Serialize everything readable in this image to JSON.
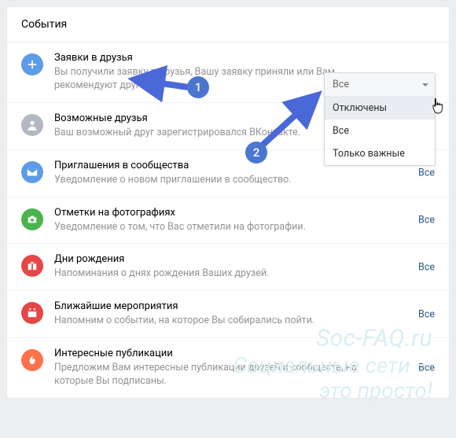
{
  "header": {
    "title": "События"
  },
  "rows": [
    {
      "icon": "plus-icon",
      "color": "ic-blue",
      "title": "Заявки в друзья",
      "desc": "Вы получили заявку в друзья, Вашу заявку приняли или Вам рекомендуют друга.",
      "action": ""
    },
    {
      "icon": "user-icon",
      "color": "ic-grey",
      "title": "Возможные друзья",
      "desc": "Ваш возможный друг зарегистрировался ВКонтакте.",
      "action": ""
    },
    {
      "icon": "envelope-icon",
      "color": "ic-blue",
      "title": "Приглашения в сообщества",
      "desc": "Уведомление о новом приглашении в сообщество.",
      "action": "Все"
    },
    {
      "icon": "camera-icon",
      "color": "ic-green",
      "title": "Отметки на фотографиях",
      "desc": "Уведомление о том, что Вас отметили на фотографии.",
      "action": "Все"
    },
    {
      "icon": "gift-icon",
      "color": "ic-red",
      "title": "Дни рождения",
      "desc": "Напоминания о днях рождения Ваших друзей.",
      "action": "Все"
    },
    {
      "icon": "calendar-icon",
      "color": "ic-red",
      "title": "Ближайшие мероприятия",
      "desc": "Напомним о событии, на которое Вы собирались пойти.",
      "action": "Все"
    },
    {
      "icon": "flame-icon",
      "color": "ic-orange",
      "title": "Интересные публикации",
      "desc": "Предложим Вам интересные публикации друзей и сообществ, на которые Вы подписаны.",
      "action": "Все"
    }
  ],
  "dropdown": {
    "selected": "Все",
    "options": [
      "Отключены",
      "Все",
      "Только важные"
    ],
    "highlighted_index": 0
  },
  "annotations": {
    "badge1": "1",
    "badge2": "2"
  },
  "watermark": {
    "line1": "Soc-FAQ.ru",
    "line2": "Социальные сети —",
    "line3": "это просто!"
  }
}
